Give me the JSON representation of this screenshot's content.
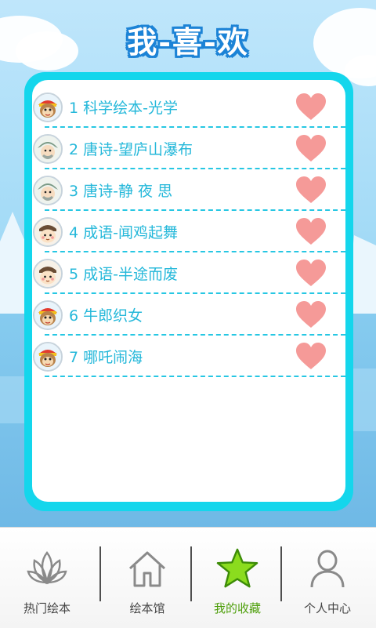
{
  "title": "我-喜-欢",
  "favorites": [
    {
      "label": "1 科学绘本-光学",
      "avatar": "monkey-king-icon"
    },
    {
      "label": "2 唐诗-望庐山瀑布",
      "avatar": "poet-icon"
    },
    {
      "label": "3 唐诗-静 夜 思",
      "avatar": "poet-icon"
    },
    {
      "label": "4 成语-闻鸡起舞",
      "avatar": "scholar-icon"
    },
    {
      "label": "5 成语-半途而废",
      "avatar": "scholar-icon"
    },
    {
      "label": "6 牛郎织女",
      "avatar": "monkey-king-icon"
    },
    {
      "label": "7 哪吒闹海",
      "avatar": "monkey-king-icon"
    }
  ],
  "colors": {
    "accent": "#14d6ec",
    "item_text": "#25b8da",
    "heart": "#f59a98",
    "active_tab": "#4e9f0b"
  },
  "tabs": [
    {
      "label": "热门绘本",
      "icon": "lotus-icon",
      "active": false
    },
    {
      "label": "绘本馆",
      "icon": "home-icon",
      "active": false
    },
    {
      "label": "我的收藏",
      "icon": "star-icon",
      "active": true
    },
    {
      "label": "个人中心",
      "icon": "person-icon",
      "active": false
    }
  ]
}
